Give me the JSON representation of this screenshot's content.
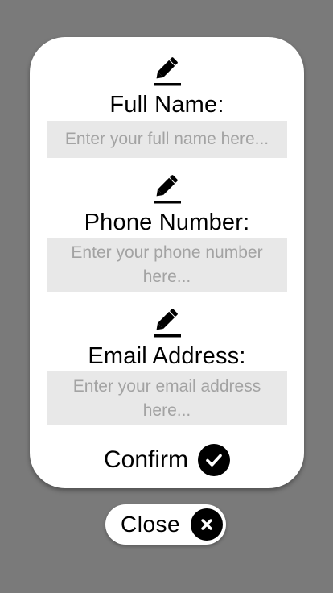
{
  "form": {
    "fields": [
      {
        "icon": "pencil-icon",
        "label": "Full Name:",
        "placeholder": "Enter your full name here..."
      },
      {
        "icon": "pencil-icon",
        "label": "Phone Number:",
        "placeholder": "Enter your phone number here..."
      },
      {
        "icon": "pencil-icon",
        "label": "Email Address:",
        "placeholder": "Enter your email address here..."
      }
    ],
    "confirm": {
      "label": "Confirm",
      "icon": "checkmark-icon"
    }
  },
  "close": {
    "label": "Close",
    "icon": "close-icon"
  },
  "colors": {
    "backdrop": "#7a7a7a",
    "card": "#ffffff",
    "input_bg": "#e8e8e8",
    "placeholder": "#a3a3a3",
    "icon": "#000000"
  }
}
